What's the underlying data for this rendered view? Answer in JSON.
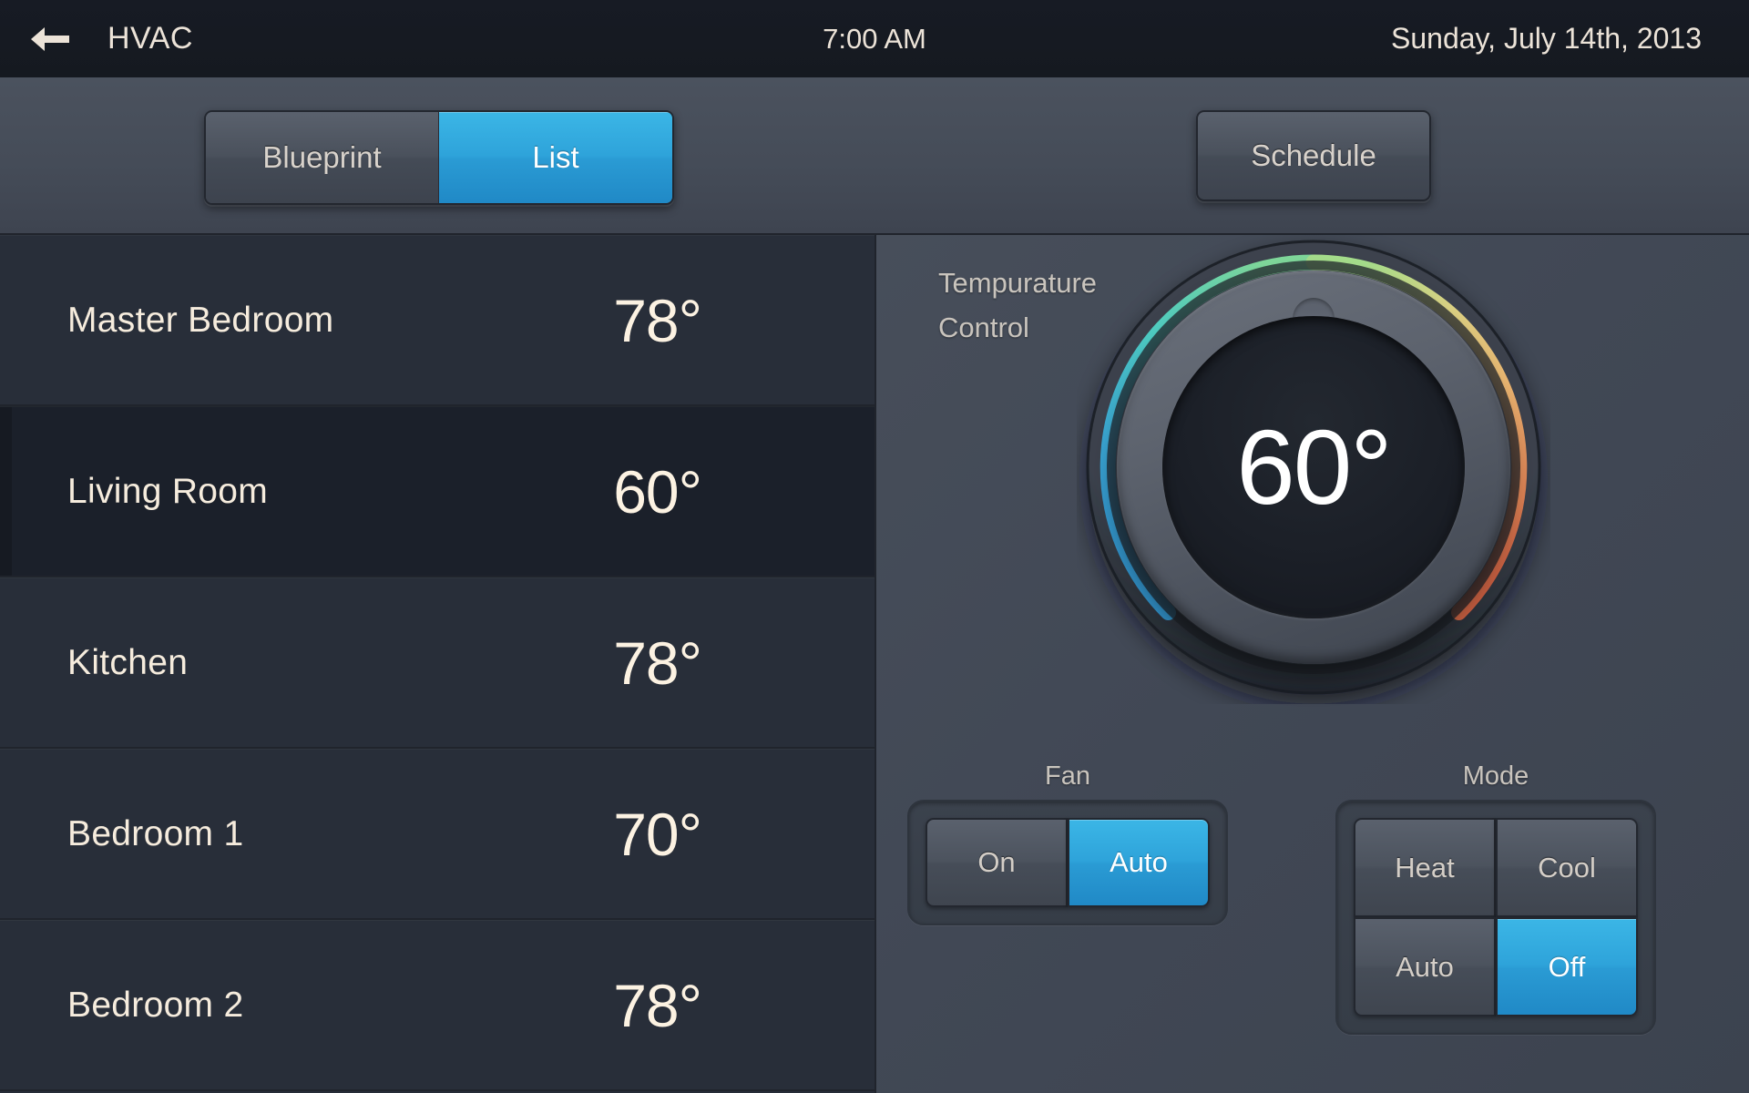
{
  "statusbar": {
    "back_icon": "arrow-left-icon",
    "app_title": "HVAC",
    "time": "7:00 AM",
    "date": "Sunday,  July 14th, 2013"
  },
  "toolbar": {
    "view_tabs": [
      {
        "label": "Blueprint",
        "active": false
      },
      {
        "label": "List",
        "active": true
      }
    ],
    "schedule_label": "Schedule"
  },
  "room_list": [
    {
      "name": "Master Bedroom",
      "temperature": "78°",
      "selected": false
    },
    {
      "name": "Living Room",
      "temperature": "60°",
      "selected": true
    },
    {
      "name": "Kitchen",
      "temperature": "78°",
      "selected": false
    },
    {
      "name": "Bedroom 1",
      "temperature": "70°",
      "selected": false
    },
    {
      "name": "Bedroom 2",
      "temperature": "78°",
      "selected": false
    }
  ],
  "control_panel": {
    "title_line1": "Tempurature",
    "title_line2": "Control",
    "dial": {
      "value": "60°",
      "knob_indicator": "dial-knob-indicator",
      "arc_gradient_stops": [
        "#2f8fcb",
        "#3fb4d8",
        "#55cdc0",
        "#8ad98e",
        "#cfd98a",
        "#e8c47a",
        "#e8a25f",
        "#df7a4c",
        "#c2392d"
      ],
      "arc_start_angle_deg": 225,
      "arc_sweep_deg": 270
    },
    "fan": {
      "label": "Fan",
      "options": [
        {
          "label": "On",
          "active": false
        },
        {
          "label": "Auto",
          "active": true
        }
      ]
    },
    "mode": {
      "label": "Mode",
      "options": [
        {
          "label": "Heat",
          "active": false
        },
        {
          "label": "Cool",
          "active": false
        },
        {
          "label": "Auto",
          "active": false
        },
        {
          "label": "Off",
          "active": true
        }
      ]
    }
  },
  "colors": {
    "accent_blue": "#2ea3da",
    "panel_bg": "#414855",
    "list_bg": "#282e39",
    "list_selected_bg": "#1b202a",
    "topbar_bg": "#161a22",
    "text_cream": "#f6ecdd",
    "text_gray": "#c9c4bd"
  }
}
